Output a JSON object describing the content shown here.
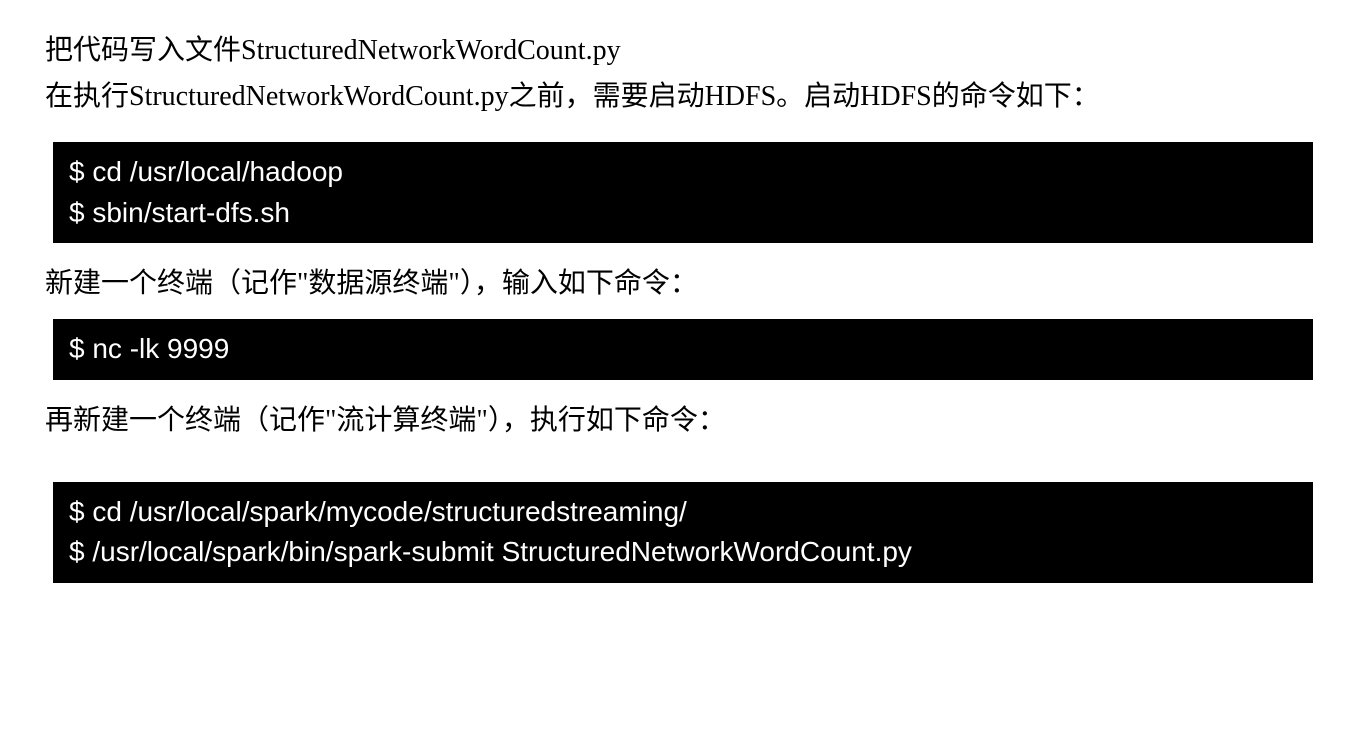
{
  "intro": {
    "line1": "把代码写入文件StructuredNetworkWordCount.py",
    "line2": "在执行StructuredNetworkWordCount.py之前，需要启动HDFS。启动HDFS的命令如下："
  },
  "codeBlock1": {
    "line1": "$ cd /usr/local/hadoop",
    "line2": "$ sbin/start-dfs.sh"
  },
  "paragraph2": "新建一个终端（记作\"数据源终端\"），输入如下命令：",
  "codeBlock2": {
    "line1": "$ nc -lk 9999"
  },
  "paragraph3": "再新建一个终端（记作\"流计算终端\"），执行如下命令：",
  "codeBlock3": {
    "line1": "$ cd /usr/local/spark/mycode/structuredstreaming/",
    "line2": "$ /usr/local/spark/bin/spark-submit StructuredNetworkWordCount.py"
  }
}
